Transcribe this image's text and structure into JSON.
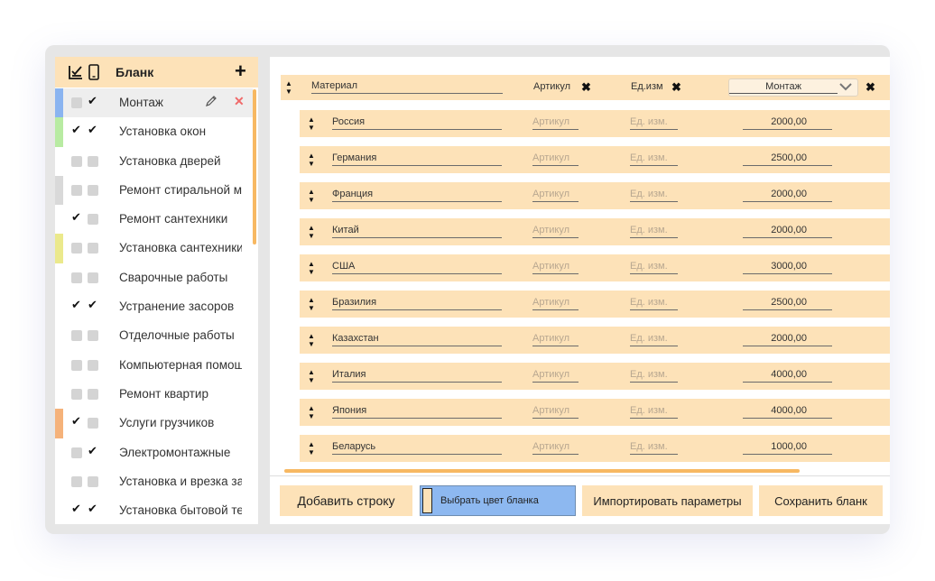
{
  "sidebar": {
    "title": "Бланк",
    "add_label": "+",
    "items": [
      {
        "label": "Монтаж",
        "check1": false,
        "check2": true,
        "color": "#8ab4f0",
        "active": true
      },
      {
        "label": "Установка окон",
        "check1": true,
        "check2": true,
        "color": "#b8eba2",
        "active": false
      },
      {
        "label": "Установка дверей",
        "check1": false,
        "check2": false,
        "color": "",
        "active": false
      },
      {
        "label": "Ремонт стиральной машины",
        "check1": false,
        "check2": false,
        "color": "#d9d9d9",
        "active": false
      },
      {
        "label": "Ремонт сантехники",
        "check1": true,
        "check2": false,
        "color": "",
        "active": false
      },
      {
        "label": "Установка сантехники",
        "check1": false,
        "check2": false,
        "color": "#ebe98c",
        "active": false
      },
      {
        "label": "Сварочные работы",
        "check1": false,
        "check2": false,
        "color": "",
        "active": false
      },
      {
        "label": "Устранение засоров",
        "check1": true,
        "check2": true,
        "color": "",
        "active": false
      },
      {
        "label": "Отделочные работы",
        "check1": false,
        "check2": false,
        "color": "",
        "active": false
      },
      {
        "label": "Компьютерная помощь",
        "check1": false,
        "check2": false,
        "color": "",
        "active": false
      },
      {
        "label": "Ремонт квартир",
        "check1": false,
        "check2": false,
        "color": "",
        "active": false
      },
      {
        "label": "Услуги грузчиков",
        "check1": true,
        "check2": false,
        "color": "#f5b27a",
        "active": false
      },
      {
        "label": "Электромонтажные",
        "check1": false,
        "check2": true,
        "color": "",
        "active": false
      },
      {
        "label": "Установка и врезка замков",
        "check1": false,
        "check2": false,
        "color": "",
        "active": false
      },
      {
        "label": "Установка бытовой техники",
        "check1": true,
        "check2": true,
        "color": "",
        "active": false
      }
    ]
  },
  "table": {
    "header": {
      "material": "Материал",
      "article": "Артикул",
      "unit": "Ед.изм",
      "selected_form": "Монтаж"
    },
    "rows": [
      {
        "material": "Россия",
        "article_placeholder": "Артикул",
        "unit_placeholder": "Ед. изм.",
        "price": "2000,00"
      },
      {
        "material": "Германия",
        "article_placeholder": "Артикул",
        "unit_placeholder": "Ед. изм.",
        "price": "2500,00"
      },
      {
        "material": "Франция",
        "article_placeholder": "Артикул",
        "unit_placeholder": "Ед. изм.",
        "price": "2000,00"
      },
      {
        "material": "Китай",
        "article_placeholder": "Артикул",
        "unit_placeholder": "Ед. изм.",
        "price": "2000,00"
      },
      {
        "material": "США",
        "article_placeholder": "Артикул",
        "unit_placeholder": "Ед. изм.",
        "price": "3000,00"
      },
      {
        "material": "Бразилия",
        "article_placeholder": "Артикул",
        "unit_placeholder": "Ед. изм.",
        "price": "2500,00"
      },
      {
        "material": "Казахстан",
        "article_placeholder": "Артикул",
        "unit_placeholder": "Ед. изм.",
        "price": "2000,00"
      },
      {
        "material": "Италия",
        "article_placeholder": "Артикул",
        "unit_placeholder": "Ед. изм.",
        "price": "4000,00"
      },
      {
        "material": "Япония",
        "article_placeholder": "Артикул",
        "unit_placeholder": "Ед. изм.",
        "price": "4000,00"
      },
      {
        "material": "Беларусь",
        "article_placeholder": "Артикул",
        "unit_placeholder": "Ед. изм.",
        "price": "1000,00"
      }
    ]
  },
  "footer": {
    "add_row": "Добавить строку",
    "pick_color": "Выбрать цвет бланка",
    "import_params": "Импортировать параметры",
    "save_form": "Сохранить бланк",
    "form_color": "#8db8f0"
  },
  "icons": {
    "header_check": "checklist-icon",
    "header_phone": "phone-icon",
    "edit": "pencil-icon",
    "delete": "close-icon",
    "sort": "sort-arrows-icon",
    "dropdown": "chevron-down-icon"
  },
  "colors": {
    "accent": "#fde2b8",
    "scrollbar": "#f7b862",
    "delete_red": "#f06a6a"
  }
}
